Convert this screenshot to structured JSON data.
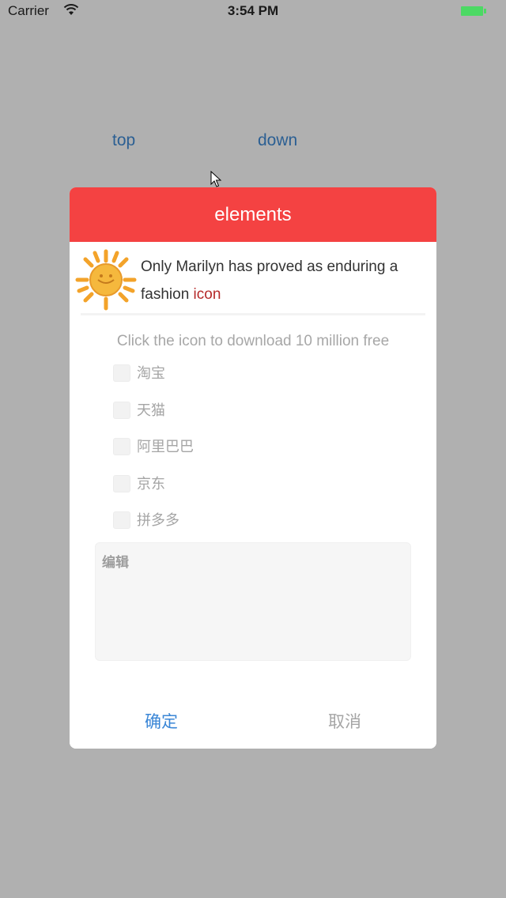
{
  "status_bar": {
    "carrier": "Carrier",
    "time": "3:54 PM",
    "battery_color": "#4cd964"
  },
  "background": {
    "top_label": "top",
    "down_label": "down"
  },
  "dialog": {
    "title": "elements",
    "header_color": "#f44242",
    "banner": {
      "text": "Only Marilyn has proved as enduring a fashion ",
      "accent": "icon"
    },
    "instruction": "Click the icon to download 10 million free",
    "options": [
      {
        "label": "淘宝",
        "checked": false
      },
      {
        "label": "天猫",
        "checked": false
      },
      {
        "label": "阿里巴巴",
        "checked": false
      },
      {
        "label": "京东",
        "checked": false
      },
      {
        "label": "拼多多",
        "checked": false
      }
    ],
    "edit": {
      "placeholder": "编辑",
      "value": ""
    },
    "confirm_label": "确定",
    "cancel_label": "取消"
  }
}
